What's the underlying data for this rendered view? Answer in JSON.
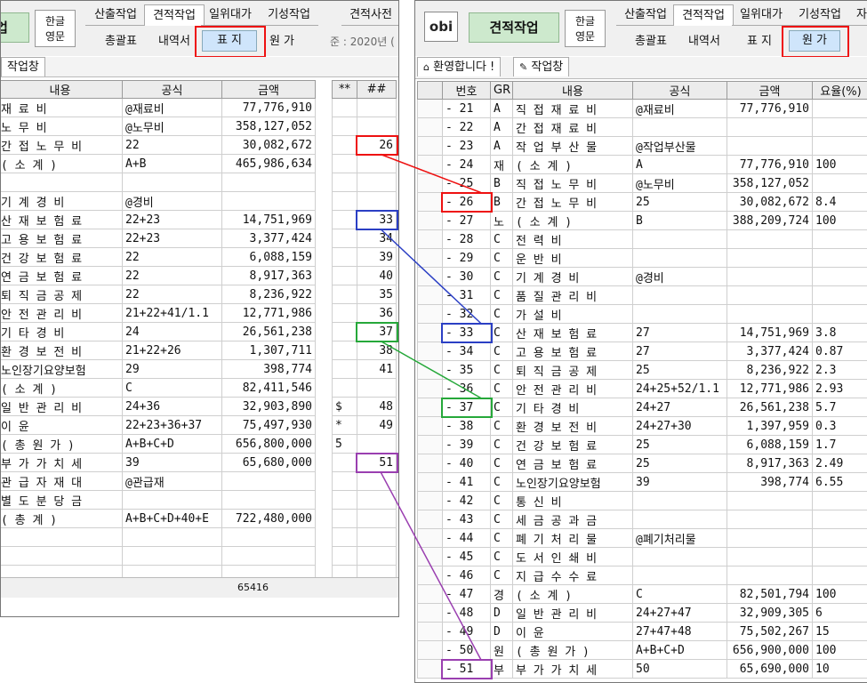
{
  "left": {
    "menu_tabs": [
      "산출작업",
      "견적작업",
      "일위대가",
      "기성작업",
      "견적사전"
    ],
    "lang_button": [
      "한글",
      "영문"
    ],
    "sub_tabs": [
      "총괄표",
      "내역서",
      "표 지",
      "원 가"
    ],
    "date_partial": "준 : 2020년 (",
    "workspace_tab": "작업창",
    "headers": [
      "내용",
      "공식",
      "금액",
      "**",
      "##"
    ],
    "rows": [
      {
        "name": "재 료 비",
        "formula": "@재료비",
        "amount": "77,776,910",
        "flag": "",
        "code": ""
      },
      {
        "name": "노 무 비",
        "formula": "@노무비",
        "amount": "358,127,052",
        "flag": "",
        "code": ""
      },
      {
        "name": "간 접 노 무 비",
        "formula": "22",
        "amount": "30,082,672",
        "flag": "",
        "code": "26"
      },
      {
        "name": "( 소 계 )",
        "formula": "A+B",
        "amount": "465,986,634",
        "flag": "",
        "code": ""
      },
      {
        "name": "",
        "formula": "",
        "amount": "",
        "flag": "",
        "code": ""
      },
      {
        "name": "기 계 경 비",
        "formula": "@경비",
        "amount": "",
        "flag": "",
        "code": ""
      },
      {
        "name": "산 재 보 험 료",
        "formula": "22+23",
        "amount": "14,751,969",
        "flag": "",
        "code": "33"
      },
      {
        "name": "고 용 보 험 료",
        "formula": "22+23",
        "amount": "3,377,424",
        "flag": "",
        "code": "34"
      },
      {
        "name": "건 강 보 험 료",
        "formula": "22",
        "amount": "6,088,159",
        "flag": "",
        "code": "39"
      },
      {
        "name": "연 금 보 험 료",
        "formula": "22",
        "amount": "8,917,363",
        "flag": "",
        "code": "40"
      },
      {
        "name": "퇴 직 금 공 제",
        "formula": "22",
        "amount": "8,236,922",
        "flag": "",
        "code": "35"
      },
      {
        "name": "안 전 관 리 비",
        "formula": "21+22+41/1.1",
        "amount": "12,771,986",
        "flag": "",
        "code": "36"
      },
      {
        "name": "기 타 경 비",
        "formula": "24",
        "amount": "26,561,238",
        "flag": "",
        "code": "37"
      },
      {
        "name": "환 경 보 전 비",
        "formula": "21+22+26",
        "amount": "1,307,711",
        "flag": "",
        "code": "38"
      },
      {
        "name": "노인장기요양보험",
        "formula": "29",
        "amount": "398,774",
        "flag": "",
        "code": "41"
      },
      {
        "name": "( 소 계 )",
        "formula": "C",
        "amount": "82,411,546",
        "flag": "",
        "code": ""
      },
      {
        "name": "일 반 관 리 비",
        "formula": "24+36",
        "amount": "32,903,890",
        "flag": "$",
        "code": "48"
      },
      {
        "name": "이 윤",
        "formula": "22+23+36+37",
        "amount": "75,497,930",
        "flag": "*",
        "code": "49"
      },
      {
        "name": "( 총 원 가 )",
        "formula": "A+B+C+D",
        "amount": "656,800,000",
        "flag": "5",
        "code": ""
      },
      {
        "name": "부 가 가 치 세",
        "formula": "39",
        "amount": "65,680,000",
        "flag": "",
        "code": "51"
      },
      {
        "name": "관 급 자 재 대",
        "formula": "@관급재",
        "amount": "",
        "flag": "",
        "code": ""
      },
      {
        "name": "별 도 분 당 금",
        "formula": "",
        "amount": "",
        "flag": "",
        "code": ""
      },
      {
        "name": "( 총 계 )",
        "formula": "A+B+C+D+40+E",
        "amount": "722,480,000",
        "flag": "",
        "code": ""
      },
      {
        "name": "",
        "formula": "",
        "amount": "",
        "flag": "",
        "code": ""
      },
      {
        "name": "",
        "formula": "",
        "amount": "",
        "flag": "",
        "code": ""
      },
      {
        "name": "",
        "formula": "",
        "amount": "",
        "flag": "",
        "code": ""
      }
    ],
    "status_value": "65416"
  },
  "right": {
    "logo_text": "obi",
    "main_button": "견적작업",
    "lang_button": [
      "한글",
      "영문"
    ],
    "menu_tabs": [
      "산출작업",
      "견적작업",
      "일위대가",
      "기성작업",
      "자"
    ],
    "sub_tabs": [
      "총괄표",
      "내역서",
      "표 지",
      "원 가"
    ],
    "workspace_tabs": [
      "환영합니다 !",
      "작업창"
    ],
    "headers": [
      "번호",
      "GR",
      "내용",
      "공식",
      "금액",
      "요율(%)"
    ],
    "rows": [
      {
        "no": "- 21",
        "gr": "A",
        "name": "직 접 재 료 비",
        "formula": "@재료비",
        "amount": "77,776,910",
        "rate": ""
      },
      {
        "no": "- 22",
        "gr": "A",
        "name": "간 접 재 료 비",
        "formula": "",
        "amount": "",
        "rate": ""
      },
      {
        "no": "- 23",
        "gr": "A",
        "name": "작 업 부 산 물",
        "formula": "@작업부산물",
        "amount": "",
        "rate": ""
      },
      {
        "no": "- 24",
        "gr": "재",
        "name": "( 소 계 )",
        "formula": "A",
        "amount": "77,776,910",
        "rate": "100"
      },
      {
        "no": "- 25",
        "gr": "B",
        "name": "직 접 노 무 비",
        "formula": "@노무비",
        "amount": "358,127,052",
        "rate": ""
      },
      {
        "no": "- 26",
        "gr": "B",
        "name": "간 접 노 무 비",
        "formula": "25",
        "amount": "30,082,672",
        "rate": "8.4"
      },
      {
        "no": "- 27",
        "gr": "노",
        "name": "( 소 계 )",
        "formula": "B",
        "amount": "388,209,724",
        "rate": "100"
      },
      {
        "no": "- 28",
        "gr": "C",
        "name": "전 력 비",
        "formula": "",
        "amount": "",
        "rate": ""
      },
      {
        "no": "- 29",
        "gr": "C",
        "name": "운 반 비",
        "formula": "",
        "amount": "",
        "rate": ""
      },
      {
        "no": "- 30",
        "gr": "C",
        "name": "기 계 경 비",
        "formula": "@경비",
        "amount": "",
        "rate": ""
      },
      {
        "no": "- 31",
        "gr": "C",
        "name": "품 질 관 리 비",
        "formula": "",
        "amount": "",
        "rate": ""
      },
      {
        "no": "- 32",
        "gr": "C",
        "name": "가 설 비",
        "formula": "",
        "amount": "",
        "rate": ""
      },
      {
        "no": "- 33",
        "gr": "C",
        "name": "산 재 보 험 료",
        "formula": "27",
        "amount": "14,751,969",
        "rate": "3.8"
      },
      {
        "no": "- 34",
        "gr": "C",
        "name": "고 용 보 험 료",
        "formula": "27",
        "amount": "3,377,424",
        "rate": "0.87"
      },
      {
        "no": "- 35",
        "gr": "C",
        "name": "퇴 직 금 공 제",
        "formula": "25",
        "amount": "8,236,922",
        "rate": "2.3"
      },
      {
        "no": "- 36",
        "gr": "C",
        "name": "안 전 관 리 비",
        "formula": "24+25+52/1.1",
        "amount": "12,771,986",
        "rate": "2.93"
      },
      {
        "no": "- 37",
        "gr": "C",
        "name": "기 타 경 비",
        "formula": "24+27",
        "amount": "26,561,238",
        "rate": "5.7"
      },
      {
        "no": "- 38",
        "gr": "C",
        "name": "환 경 보 전 비",
        "formula": "24+27+30",
        "amount": "1,397,959",
        "rate": "0.3"
      },
      {
        "no": "- 39",
        "gr": "C",
        "name": "건 강 보 험 료",
        "formula": "25",
        "amount": "6,088,159",
        "rate": "1.7"
      },
      {
        "no": "- 40",
        "gr": "C",
        "name": "연 금 보 험 료",
        "formula": "25",
        "amount": "8,917,363",
        "rate": "2.49"
      },
      {
        "no": "- 41",
        "gr": "C",
        "name": "노인장기요양보험",
        "formula": "39",
        "amount": "398,774",
        "rate": "6.55"
      },
      {
        "no": "- 42",
        "gr": "C",
        "name": "통 신 비",
        "formula": "",
        "amount": "",
        "rate": ""
      },
      {
        "no": "- 43",
        "gr": "C",
        "name": "세 금 공 과 금",
        "formula": "",
        "amount": "",
        "rate": ""
      },
      {
        "no": "- 44",
        "gr": "C",
        "name": "폐 기 처 리 물",
        "formula": "@폐기처리물",
        "amount": "",
        "rate": ""
      },
      {
        "no": "- 45",
        "gr": "C",
        "name": "도 서 인 쇄 비",
        "formula": "",
        "amount": "",
        "rate": ""
      },
      {
        "no": "- 46",
        "gr": "C",
        "name": "지 급 수 수 료",
        "formula": "",
        "amount": "",
        "rate": ""
      },
      {
        "no": "- 47",
        "gr": "경",
        "name": "( 소 계 )",
        "formula": "C",
        "amount": "82,501,794",
        "rate": "100"
      },
      {
        "no": "- 48",
        "gr": "D",
        "name": "일 반 관 리 비",
        "formula": "24+27+47",
        "amount": "32,909,305",
        "rate": "6"
      },
      {
        "no": "- 49",
        "gr": "D",
        "name": "이 윤",
        "formula": "27+47+48",
        "amount": "75,502,267",
        "rate": "15"
      },
      {
        "no": "- 50",
        "gr": "원",
        "name": "( 총 원 가 )",
        "formula": "A+B+C+D",
        "amount": "656,900,000",
        "rate": "100"
      },
      {
        "no": "- 51",
        "gr": "부",
        "name": "부 가 가 치 세",
        "formula": "50",
        "amount": "65,690,000",
        "rate": "10"
      }
    ]
  },
  "colors": {
    "red": "#e11",
    "blue": "#2b3fc4",
    "green": "#26a83a",
    "purple": "#9a3fb0"
  }
}
